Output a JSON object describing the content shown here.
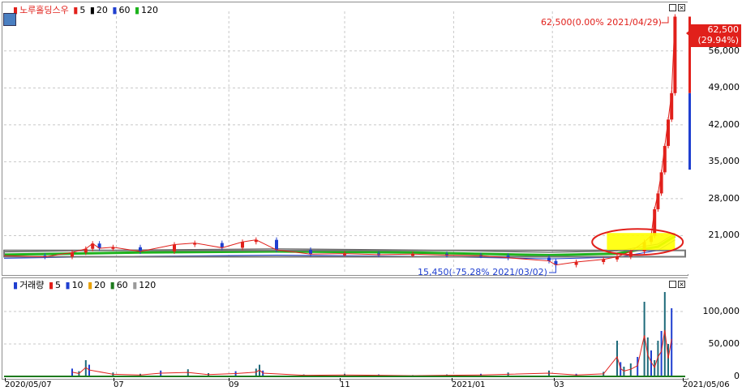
{
  "price_legend": {
    "name": "노루홀딩스우",
    "items": [
      {
        "label": "5",
        "color": "#e1201b"
      },
      {
        "label": "20",
        "color": "#000000"
      },
      {
        "label": "60",
        "color": "#1f3fd0"
      },
      {
        "label": "120",
        "color": "#1db31d"
      }
    ]
  },
  "volume_legend": {
    "name": "거래량",
    "items": [
      {
        "label": "5",
        "color": "#e1201b"
      },
      {
        "label": "10",
        "color": "#1f3fd0"
      },
      {
        "label": "20",
        "color": "#e8a000"
      },
      {
        "label": "60",
        "color": "#1e7a1e"
      },
      {
        "label": "120",
        "color": "#9a9a9a"
      }
    ]
  },
  "annotations": {
    "high": "62,500(0.00% 2021/04/29)",
    "low": "15,450(-75.28% 2021/03/02)"
  },
  "current_price": {
    "value": "62,500",
    "change": "(29.94%)"
  },
  "colors": {
    "up": "#e1201b",
    "down": "#1f3fd0",
    "highlight": "#ffff00",
    "circle": "#e1201b"
  },
  "chart_data": [
    {
      "type": "candlestick",
      "title": "노루홀딩스우",
      "y_ticks": [
        "56,000",
        "49,000",
        "42,000",
        "35,000",
        "28,000",
        "21,000"
      ],
      "y_tick_values": [
        56000,
        49000,
        42000,
        35000,
        28000,
        21000
      ],
      "ylim": [
        14000,
        63500
      ],
      "x_ticks": [
        "2020/05/07",
        "07",
        "09",
        "11",
        "2021/01",
        "03",
        "2021/05/06"
      ],
      "series": [
        {
          "name": "5",
          "color": "#e1201b"
        },
        {
          "name": "20",
          "color": "#000000"
        },
        {
          "name": "60",
          "color": "#1f3fd0"
        },
        {
          "name": "120",
          "color": "#1db31d"
        }
      ],
      "close_path": [
        [
          0,
          17200
        ],
        [
          0.06,
          17000
        ],
        [
          0.1,
          17800
        ],
        [
          0.12,
          18500
        ],
        [
          0.13,
          19500
        ],
        [
          0.14,
          18600
        ],
        [
          0.16,
          18800
        ],
        [
          0.2,
          18000
        ],
        [
          0.25,
          19300
        ],
        [
          0.28,
          19600
        ],
        [
          0.32,
          18700
        ],
        [
          0.35,
          19800
        ],
        [
          0.37,
          20200
        ],
        [
          0.4,
          18300
        ],
        [
          0.45,
          17500
        ],
        [
          0.5,
          17600
        ],
        [
          0.55,
          17400
        ],
        [
          0.6,
          17500
        ],
        [
          0.65,
          17300
        ],
        [
          0.7,
          17200
        ],
        [
          0.74,
          16800
        ],
        [
          0.8,
          16200
        ],
        [
          0.81,
          15450
        ],
        [
          0.84,
          16000
        ],
        [
          0.88,
          16500
        ],
        [
          0.9,
          17000
        ],
        [
          0.92,
          18000
        ],
        [
          0.94,
          19800
        ],
        [
          0.95,
          21000
        ],
        [
          0.955,
          26000
        ],
        [
          0.96,
          29000
        ],
        [
          0.965,
          33000
        ],
        [
          0.97,
          38000
        ],
        [
          0.975,
          43000
        ],
        [
          0.98,
          48000
        ],
        [
          0.985,
          62500
        ]
      ],
      "high": 62500,
      "low": 15450,
      "current": 62500,
      "grid": true
    },
    {
      "type": "bar",
      "title": "거래량",
      "y_ticks": [
        "100,000",
        "50,000",
        "0"
      ],
      "y_tick_values": [
        100000,
        50000,
        0
      ],
      "ylim": [
        0,
        135000
      ],
      "bars": [
        [
          0.1,
          12000
        ],
        [
          0.11,
          8000
        ],
        [
          0.12,
          25000
        ],
        [
          0.125,
          18000
        ],
        [
          0.16,
          6000
        ],
        [
          0.2,
          4000
        ],
        [
          0.23,
          9000
        ],
        [
          0.27,
          11000
        ],
        [
          0.3,
          5000
        ],
        [
          0.34,
          8000
        ],
        [
          0.37,
          12000
        ],
        [
          0.375,
          18000
        ],
        [
          0.38,
          9000
        ],
        [
          0.44,
          3000
        ],
        [
          0.5,
          4000
        ],
        [
          0.55,
          3000
        ],
        [
          0.6,
          2000
        ],
        [
          0.65,
          3000
        ],
        [
          0.7,
          4000
        ],
        [
          0.74,
          6000
        ],
        [
          0.8,
          9000
        ],
        [
          0.84,
          4000
        ],
        [
          0.88,
          7000
        ],
        [
          0.9,
          55000
        ],
        [
          0.905,
          22000
        ],
        [
          0.91,
          15000
        ],
        [
          0.92,
          20000
        ],
        [
          0.93,
          30000
        ],
        [
          0.94,
          115000
        ],
        [
          0.945,
          60000
        ],
        [
          0.95,
          40000
        ],
        [
          0.955,
          25000
        ],
        [
          0.96,
          55000
        ],
        [
          0.965,
          70000
        ],
        [
          0.97,
          130000
        ],
        [
          0.975,
          50000
        ],
        [
          0.98,
          105000
        ]
      ],
      "grid": true
    }
  ]
}
